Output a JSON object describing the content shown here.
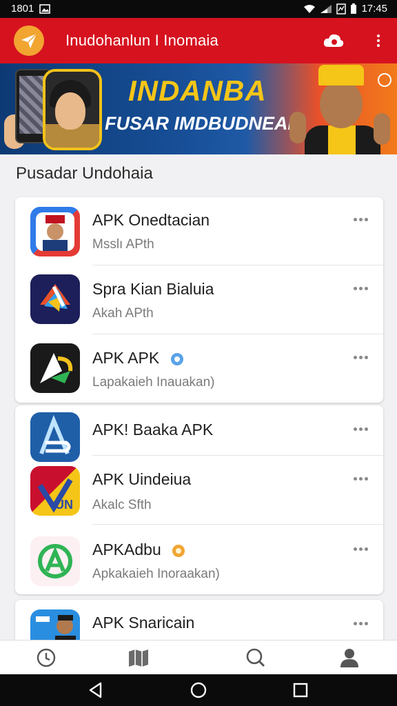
{
  "status_bar": {
    "left_text": "1801",
    "time": "17:45"
  },
  "app_bar": {
    "title": "Inudohanlun I Inomaia"
  },
  "banner": {
    "line1": "INDANBA",
    "line2": "FUSAR IMDBUDNEAI"
  },
  "section": {
    "title": "Pusadar Undohaia"
  },
  "apps": [
    {
      "name": "APK Onedtacian",
      "sub": "Msslı APth",
      "verified": null
    },
    {
      "name": "Spra Kian Bialuia",
      "sub": "Akah APth",
      "verified": null
    },
    {
      "name": "APK APK",
      "sub": "Lapakaieh Inauakan)",
      "verified": "blue"
    },
    {
      "name": "APK! Baaka APK",
      "sub": "",
      "verified": null
    },
    {
      "name": "APK Uindeiua",
      "sub": "Akalc Sfth",
      "verified": null
    },
    {
      "name": "APKAdbu",
      "sub": "Apkakaieh Inoraakan)",
      "verified": "gold"
    },
    {
      "name": "APK Snaricain",
      "sub": "",
      "verified": null
    }
  ],
  "bottom_nav": [
    {
      "icon": "clock-icon"
    },
    {
      "icon": "map-icon"
    },
    {
      "icon": "search-icon"
    },
    {
      "icon": "profile-icon"
    }
  ],
  "colors": {
    "brand": "#d6121f",
    "accent": "#f2a531",
    "status_bar": "#0b0b0b"
  }
}
